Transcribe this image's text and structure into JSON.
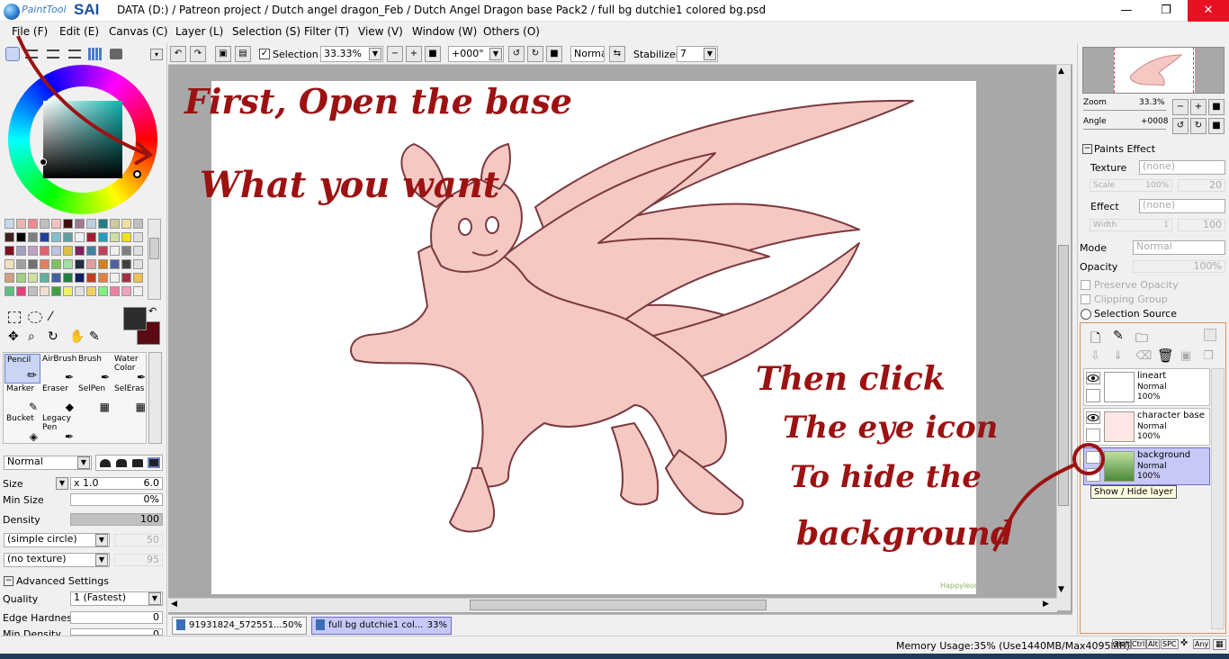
{
  "window": {
    "app_name_small": "PaintTool",
    "app_name_big": "SAI",
    "title": "DATA (D:) / Patreon project / Dutch angel dragon_Feb / Dutch Angel Dragon base Pack2 / full bg dutchie1 colored bg.psd",
    "minimize_glyph": "—",
    "maximize_glyph": "❐",
    "close_glyph": "✕"
  },
  "menu": [
    "File (F)",
    "Edit (E)",
    "Canvas (C)",
    "Layer (L)",
    "Selection (S)",
    "Filter (T)",
    "View (V)",
    "Window (W)",
    "Others (O)"
  ],
  "canvas_toolbar": {
    "selection_label": "Selection",
    "zoom": "33.33%",
    "rotation": "+000°",
    "blend_mode": "Normal",
    "stabilizer_label": "Stabilizer",
    "stabilizer_value": "7"
  },
  "tools": [
    {
      "label": "Pencil",
      "selected": true
    },
    {
      "label": "AirBrush",
      "selected": false
    },
    {
      "label": "Brush",
      "selected": false
    },
    {
      "label": "Water Color",
      "selected": false
    },
    {
      "label": "Marker",
      "selected": false
    },
    {
      "label": "Eraser",
      "selected": false
    },
    {
      "label": "SelPen",
      "selected": false
    },
    {
      "label": "SelEras",
      "selected": false
    },
    {
      "label": "Bucket",
      "selected": false
    },
    {
      "label": "Legacy Pen",
      "selected": false
    }
  ],
  "brush_settings": {
    "blend_mode": "Normal",
    "size_label": "Size",
    "size_multiplier": "x 1.0",
    "size_value": "6.0",
    "min_size_label": "Min Size",
    "min_size_value": "0%",
    "density_label": "Density",
    "density_value": "100",
    "shape": "(simple circle)",
    "shape_value": "50",
    "texture": "(no texture)",
    "texture_value": "95",
    "advanced_label": "Advanced Settings",
    "quality_label": "Quality",
    "quality_value": "1 (Fastest)",
    "edge_hardness_label": "Edge Hardness",
    "edge_hardness_value": "0",
    "min_density_label": "Min Density",
    "min_density_value": "0"
  },
  "navigator": {
    "zoom_label": "Zoom",
    "zoom_value": "33.3%",
    "angle_label": "Angle",
    "angle_value": "+0008"
  },
  "paints_effect": {
    "header": "Paints Effect",
    "texture_label": "Texture",
    "texture_value": "(none)",
    "scale_label": "Scale",
    "scale_value": "100%",
    "scale_num": "20",
    "effect_label": "Effect",
    "effect_value": "(none)",
    "width_label": "Width",
    "width_value": "1",
    "width_num": "100"
  },
  "layer_props": {
    "mode_label": "Mode",
    "mode_value": "Normal",
    "opacity_label": "Opacity",
    "opacity_value": "100%",
    "preserve_opacity": "Preserve Opacity",
    "clipping_group": "Clipping Group",
    "selection_source": "Selection Source"
  },
  "layers": [
    {
      "name": "lineart",
      "mode": "Normal",
      "opacity": "100%",
      "visible": true,
      "selected": false
    },
    {
      "name": "character base",
      "mode": "Normal",
      "opacity": "100%",
      "visible": true,
      "selected": false
    },
    {
      "name": "background",
      "mode": "Normal",
      "opacity": "100%",
      "visible": false,
      "selected": true
    }
  ],
  "tooltip": "Show / Hide layer",
  "doc_tabs": [
    {
      "name": "91931824_572551...",
      "zoom": "50%",
      "active": false
    },
    {
      "name": "full bg dutchie1 col...",
      "zoom": "33%",
      "active": true
    }
  ],
  "status": {
    "memory": "Memory Usage:35% (Use1440MB/Max4095MB)",
    "keys": [
      "Shift",
      "Ctrl",
      "Alt",
      "SPC",
      "Any"
    ]
  },
  "annotations": {
    "line1": "First, Open the base",
    "line2": "What you want",
    "line3": "Then click",
    "line4": "The eye icon",
    "line5": "To hide the",
    "line6": "background",
    "signature": "Happyleonel"
  },
  "colors": {
    "accent_red": "#9c1212",
    "dragon_fill": "#f6c8c4",
    "dragon_line": "#7a3a3e",
    "selected_layer": "#c8c8f8",
    "close_red": "#e81123"
  }
}
